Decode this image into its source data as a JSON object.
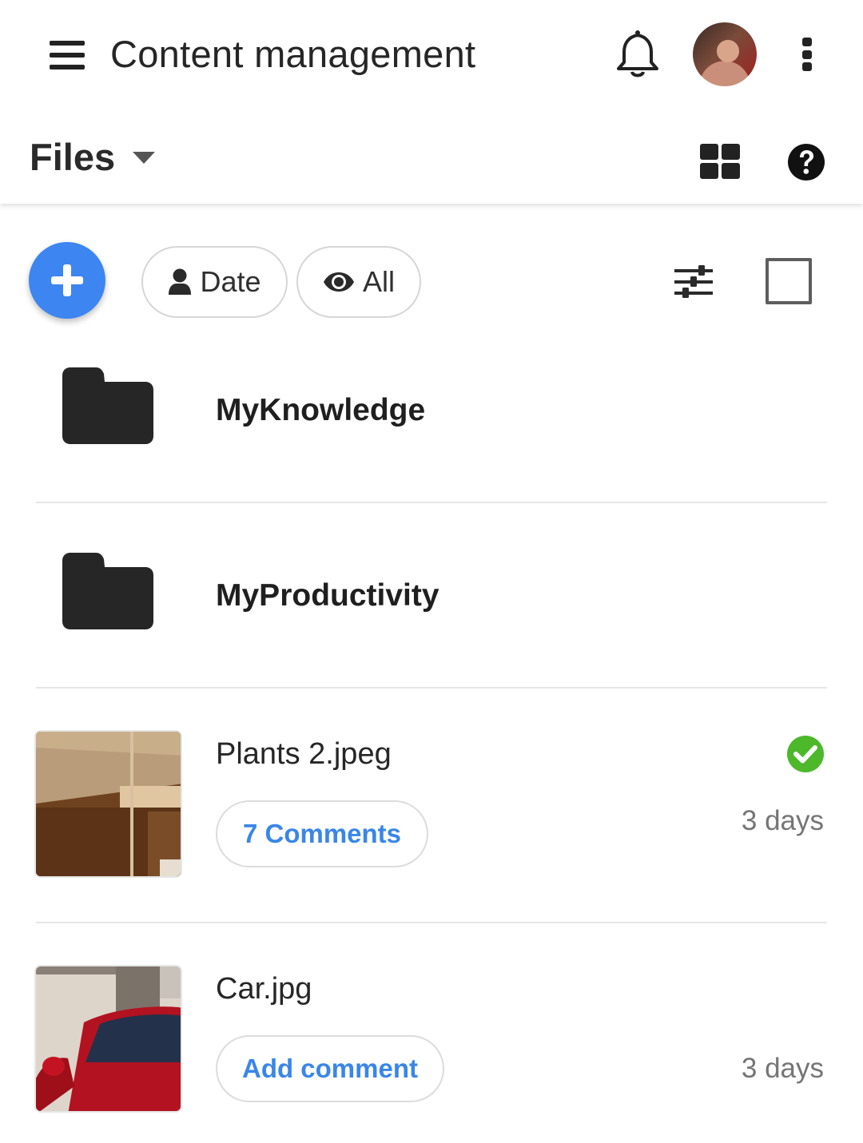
{
  "app_bar": {
    "title": "Content management",
    "menu_icon": "hamburger-menu-icon",
    "notification_icon": "bell-icon",
    "avatar_alt": "avatar",
    "overflow_icon": "more-vertical-icon"
  },
  "section": {
    "title": "Files",
    "dropdown_icon": "caret-down-icon",
    "view_icon": "grid-view-icon",
    "help_icon": "help-icon"
  },
  "toolbar": {
    "add_icon": "plus-icon",
    "chips": [
      {
        "label": "Date",
        "icon": "person-icon"
      },
      {
        "label": "All",
        "icon": "eye-icon"
      }
    ],
    "filter_icon": "sliders-icon",
    "select_icon": "checkbox-icon"
  },
  "items": [
    {
      "type": "folder",
      "name": "MyKnowledge"
    },
    {
      "type": "folder",
      "name": "MyProductivity"
    },
    {
      "type": "file",
      "name": "Plants 2.jpeg",
      "comments_label": "7 Comments",
      "age": "3 days",
      "status": "approved"
    },
    {
      "type": "file",
      "name": "Car.jpg",
      "comments_label": "Add comment",
      "age": "3 days"
    }
  ],
  "colors": {
    "accent": "#3d85f0",
    "link": "#3a86e8",
    "success": "#4cb82a",
    "icon_dark": "#222222"
  }
}
